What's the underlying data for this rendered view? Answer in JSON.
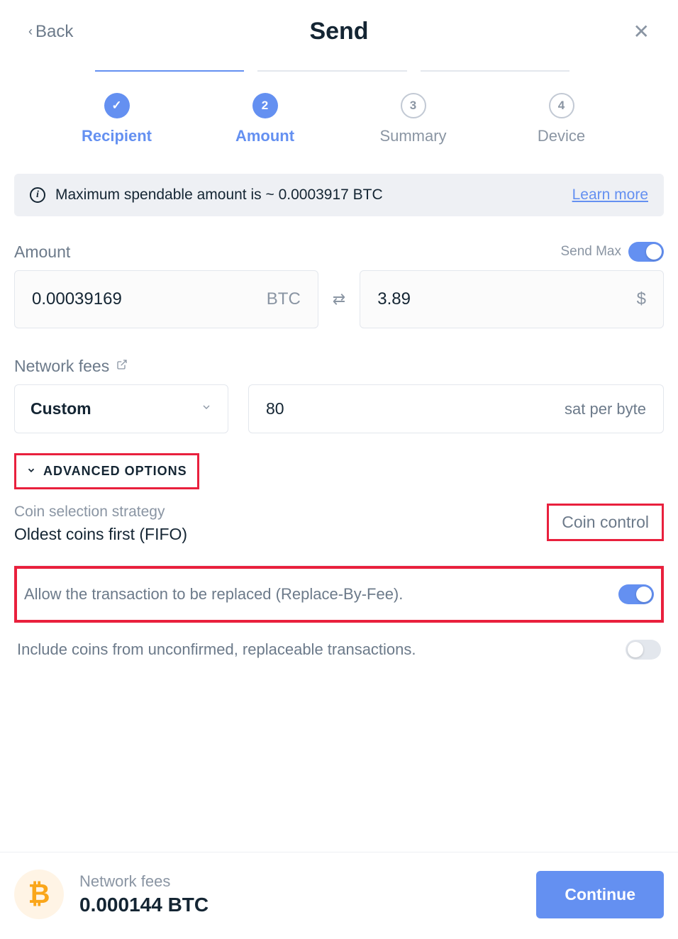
{
  "header": {
    "back_label": "Back",
    "title": "Send"
  },
  "stepper": {
    "steps": [
      {
        "label": "Recipient",
        "state": "done",
        "num": ""
      },
      {
        "label": "Amount",
        "state": "active",
        "num": "2"
      },
      {
        "label": "Summary",
        "state": "pending",
        "num": "3"
      },
      {
        "label": "Device",
        "state": "pending",
        "num": "4"
      }
    ]
  },
  "info": {
    "text": "Maximum spendable amount is ~ 0.0003917 BTC",
    "learn_more": "Learn more"
  },
  "amount": {
    "label": "Amount",
    "send_max_label": "Send Max",
    "send_max_on": true,
    "crypto_value": "0.00039169",
    "crypto_currency": "BTC",
    "fiat_value": "3.89",
    "fiat_currency": "$"
  },
  "fees": {
    "label": "Network fees",
    "selector_value": "Custom",
    "rate_value": "80",
    "rate_unit": "sat per byte"
  },
  "advanced": {
    "toggle_label": "ADVANCED OPTIONS",
    "coin_strategy_label": "Coin selection strategy",
    "coin_strategy_value": "Oldest coins first (FIFO)",
    "coin_control_btn": "Coin control",
    "rbf_label": "Allow the transaction to be replaced (Replace-By-Fee).",
    "rbf_on": true,
    "unconfirmed_label": "Include coins from unconfirmed, replaceable transactions.",
    "unconfirmed_on": false
  },
  "footer": {
    "fees_label": "Network fees",
    "fees_value": "0.000144 BTC",
    "continue_label": "Continue"
  }
}
